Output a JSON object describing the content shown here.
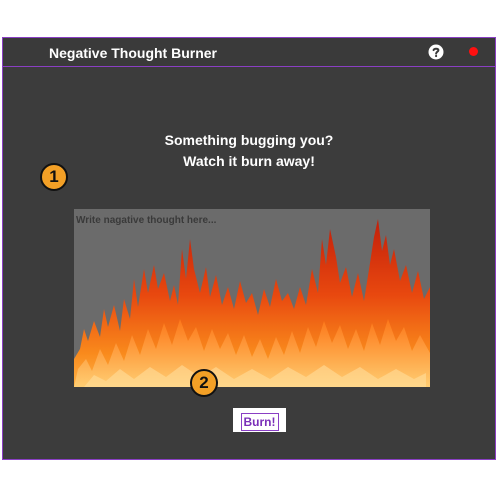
{
  "app": {
    "title": "Negative Thought Burner"
  },
  "icons": {
    "help": "help-icon",
    "close": "close-icon"
  },
  "colors": {
    "background": "#3c3c3c",
    "accent": "#8a3fc4",
    "close": "#ff1010",
    "callout": "#f3a026"
  },
  "main": {
    "headline_line1": "Something bugging you?",
    "headline_line2": "Watch it burn away!",
    "input_placeholder": "Write nagative thought here...",
    "burn_label": "Burn!"
  },
  "callouts": [
    "1",
    "2"
  ]
}
